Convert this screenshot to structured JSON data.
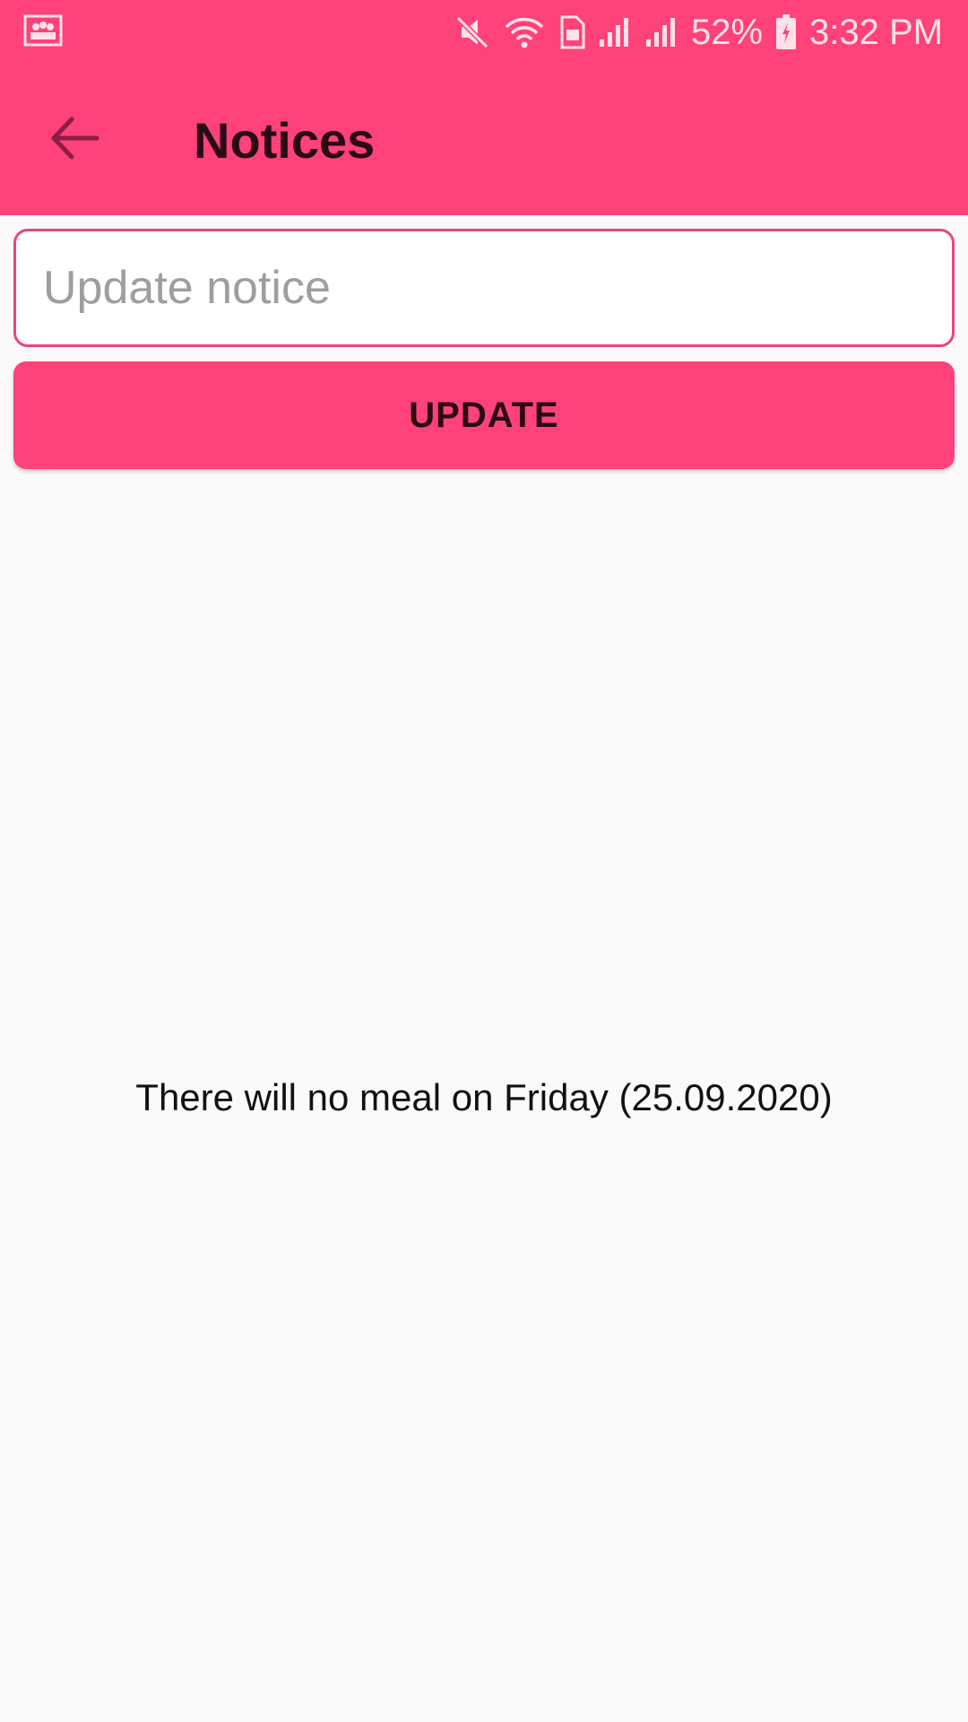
{
  "status_bar": {
    "battery": "52%",
    "time": "3:32 PM",
    "icons": [
      "gallery-notification-icon",
      "mute-icon",
      "wifi-icon",
      "sim-icon",
      "signal-icon",
      "signal-icon",
      "battery-charging-icon"
    ]
  },
  "app_bar": {
    "title": "Notices",
    "back_icon": "arrow-left-icon"
  },
  "form": {
    "input_placeholder": "Update notice",
    "input_value": "",
    "button_label": "UPDATE"
  },
  "notice": {
    "text": "There will no meal on Friday (25.09.2020)"
  },
  "colors": {
    "primary": "#FF4279",
    "input_border": "#E8457A",
    "background": "#FAFAFA"
  }
}
